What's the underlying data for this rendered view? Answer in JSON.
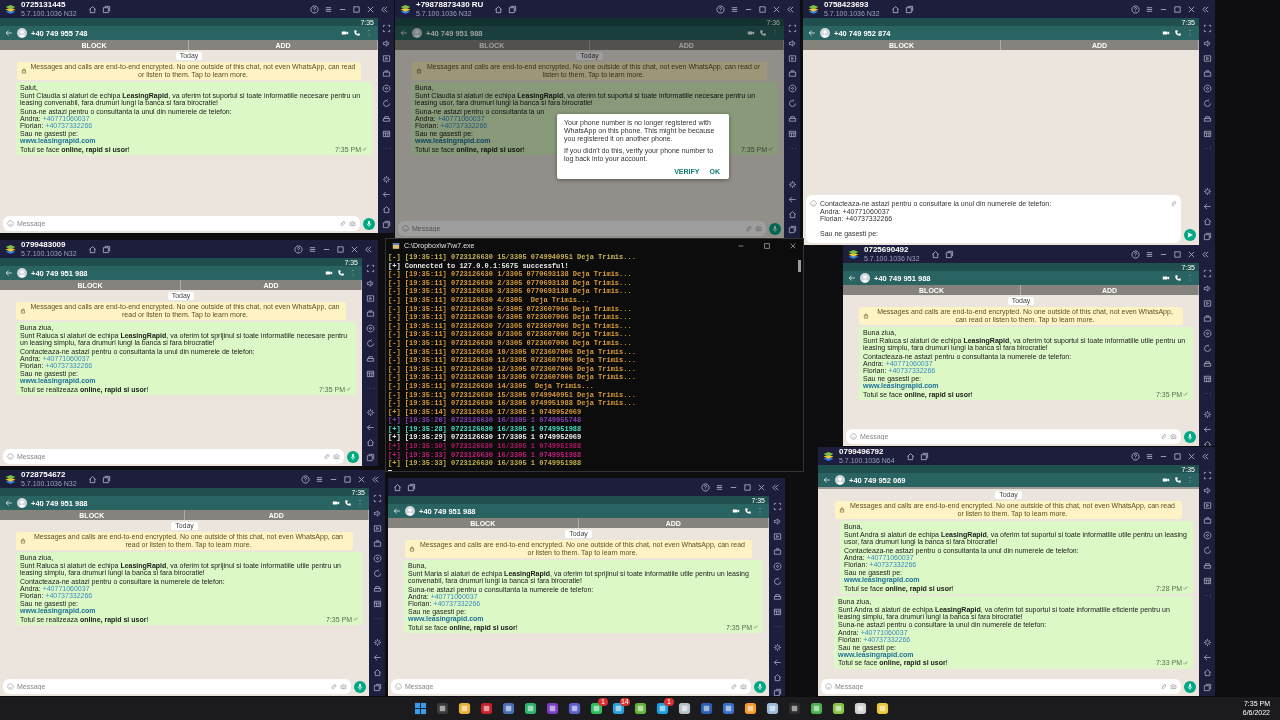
{
  "emulator_windows": [
    {
      "title": "0725131445",
      "subtitle": "5.7.100.1036 N32",
      "time": "7:35",
      "contact": "+40 749 955 748",
      "action_bar": [
        "BLOCK",
        "ADD"
      ],
      "date_chip": "Today",
      "notice": "Messages and calls are end-to-end encrypted. No one outside of this chat, not even WhatsApp, can read or listen to them. Tap to learn more.",
      "messages": [
        {
          "indent": false,
          "time": "7:35 PM",
          "paragraphs": [
            [
              {
                "text": "Salut,"
              }
            ],
            [
              {
                "text": "Sunt Claudia si alaturi de echipa **LeasingRapid**, va oferim tot suportul si toate informatiile necesare pentru un leasing convenabil, fara drumuri lungi la banca si fara birocratie!"
              }
            ],
            [
              {
                "text": "Suna-ne astazi pentru o consultanta la unul din numerele de telefon:"
              },
              {
                "label": "Andra:",
                "link": "+40771060037"
              },
              {
                "label": "Florian:",
                "link": "+40737332266"
              }
            ],
            [
              {
                "text": "Sau ne gasesti pe:"
              },
              {
                "link": "www.leasingrapid.com"
              }
            ],
            [
              {
                "text": "Totul se face **online, rapid si usor**!"
              }
            ]
          ]
        }
      ],
      "composer": {
        "placeholder": "Message"
      }
    },
    {
      "title": "+79878873430 RU",
      "subtitle": "5.7.100.1036 N32",
      "time": "7:36",
      "contact": "+40 749 951 988",
      "action_bar": [
        "BLOCK",
        "ADD"
      ],
      "date_chip": "Today",
      "notice": "Messages and calls are end-to-end encrypted. No one outside of this chat, not even WhatsApp, can read or listen to them. Tap to learn more.",
      "messages": [
        {
          "indent": false,
          "time": "7:35 PM",
          "paragraphs": [
            [
              {
                "text": "Buna,"
              }
            ],
            [
              {
                "text": "Sunt Claudia si alaturi de echipa **LeasingRapid**, va oferim tot suportul si toate informatiile necesare pentru un leasing usor, fara drumuri lungi la banca si fara birocratie!"
              }
            ],
            [
              {
                "text": "Suna-ne astazi pentru o consultanta la un"
              },
              {
                "label": "Andra:",
                "link": "+40771060037"
              },
              {
                "label": "Florian:",
                "link": "+40737332266"
              }
            ],
            [
              {
                "text": "Sau ne gasesti pe:"
              },
              {
                "link": "www.leasingrapid.com"
              }
            ],
            [
              {
                "text": "Totul se face **online, rapid si usor**!"
              }
            ]
          ]
        }
      ],
      "composer": {
        "placeholder": "Message"
      },
      "dialog": {
        "paragraphs": [
          "Your phone number is no longer registered with WhatsApp on this phone. This might be because you registered it on another phone.",
          "If you didn't do this, verify your phone number to log back into your account."
        ],
        "buttons": [
          "VERIFY",
          "OK"
        ]
      }
    },
    {
      "title": "0758423693",
      "subtitle": "5.7.100.1036 N32",
      "time": "7:35",
      "contact": "+40 749 952 874",
      "action_bar": [
        "BLOCK",
        "ADD"
      ],
      "composer": {
        "value": "Contacteaza-ne astazi pentru o consultare la unul din numerele de telefon:\nAndra: +40771060037\nFlorian: +40737332266\n\nSau ne gasesti pe:"
      }
    },
    {
      "title": "0799483009",
      "subtitle": "5.7.100.1036 N32",
      "time": "7:35",
      "contact": "+40 749 951 988",
      "action_bar": [
        "BLOCK",
        "ADD"
      ],
      "date_chip": "Today",
      "notice": "Messages and calls are end-to-end encrypted. No one outside of this chat, not even WhatsApp, can read or listen to them. Tap to learn more.",
      "messages": [
        {
          "indent": false,
          "time": "7:35 PM",
          "paragraphs": [
            [
              {
                "text": "Buna ziua,"
              }
            ],
            [
              {
                "text": "Sunt Raluca si alaturi de echipa **LeasingRapid**, va oferim tot sprijinul si toate informatiile necesare pentru un leasing simplu, fara drumuri lungi la banca si fara birocratie!"
              }
            ],
            [
              {
                "text": "Contacteaza-ne astazi pentru o consultanta la unul din numerele de telefon:"
              },
              {
                "label": "Andra:",
                "link": "+40771060037"
              },
              {
                "label": "Florian:",
                "link": "+40737332266"
              }
            ],
            [
              {
                "text": "Sau ne gasesti pe:"
              },
              {
                "link": "www.leasingrapid.com"
              }
            ],
            [
              {
                "text": "Totul se realizeaza **online, rapid si usor**!"
              }
            ]
          ]
        }
      ],
      "composer": {
        "placeholder": "Message"
      }
    },
    {
      "title": "0725690492",
      "subtitle": "5.7.100.1036 N32",
      "time": "7:35",
      "contact": "+40 749 951 988",
      "action_bar": [
        "BLOCK",
        "ADD"
      ],
      "date_chip": "Today",
      "notice": "Messages and calls are end-to-end encrypted. No one outside of this chat, not even WhatsApp, can read or listen to them. Tap to learn more.",
      "messages": [
        {
          "indent": false,
          "time": "7:35 PM",
          "paragraphs": [
            [
              {
                "text": "Buna ziua,"
              }
            ],
            [
              {
                "text": "Sunt Raluca si alaturi de echipa **LeasingRapid**, va oferim tot suportul si toate informatiile utile pentru un leasing simplu, fara drumuri lungi la banca si fara birocratie!"
              }
            ],
            [
              {
                "text": "Contacteaza-ne astazi pentru o consultanta la numerele de telefon:"
              },
              {
                "label": "Andra:",
                "link": "+40771060037"
              },
              {
                "label": "Florian:",
                "link": "+40737332266"
              }
            ],
            [
              {
                "text": "Sau ne gasesti pe:"
              },
              {
                "link": "www.leasingrapid.com"
              }
            ],
            [
              {
                "text": "Totul se face **online, rapid si usor**!"
              }
            ]
          ]
        }
      ],
      "composer": {
        "placeholder": "Message"
      }
    },
    {
      "title": "0728754672",
      "subtitle": "5.7.100.1036 N32",
      "time": "7:35",
      "contact": "+40 749 951 988",
      "action_bar": [
        "BLOCK",
        "ADD"
      ],
      "date_chip": "Today",
      "notice": "Messages and calls are end-to-end encrypted. No one outside of this chat, not even WhatsApp, can read or listen to them. Tap to learn more.",
      "messages": [
        {
          "indent": false,
          "time": "7:35 PM",
          "paragraphs": [
            [
              {
                "text": "Buna ziua,"
              }
            ],
            [
              {
                "text": "Sunt Raluca si alaturi de echipa **LeasingRapid**, va oferim tot sprijinul si toate informatiile utile pentru un leasing simplu, fara drumuri lungi la banca si fara birocratie!"
              }
            ],
            [
              {
                "text": "Contacteaza-ne astazi pentru o consultare la numerele de telefon:"
              },
              {
                "label": "Andra:",
                "link": "+40771060037"
              },
              {
                "label": "Florian:",
                "link": "+40737332266"
              }
            ],
            [
              {
                "text": "Sau ne gasesti pe:"
              },
              {
                "link": "www.leasingrapid.com"
              }
            ],
            [
              {
                "text": "Totul se realizeaza **online, rapid si usor**!"
              }
            ]
          ]
        }
      ],
      "composer": {
        "placeholder": "Message"
      }
    },
    {
      "time": "7:35",
      "contact": "+40 749 951 988",
      "action_bar": [
        "BLOCK",
        "ADD"
      ],
      "date_chip": "Today",
      "notice": "Messages and calls are end-to-end encrypted. No one outside of this chat, not even WhatsApp, can read or listen to them. Tap to learn more.",
      "messages": [
        {
          "indent": false,
          "time": "7:35 PM",
          "paragraphs": [
            [
              {
                "text": "Buna,"
              }
            ],
            [
              {
                "text": "Sunt Maria si alaturi de echipa **LeasingRapid**, va oferim tot sprijinul si toate informatiile utile pentru un leasing convenabil, fara drumuri lungi la banca si fara birocratie!"
              }
            ],
            [
              {
                "text": "Suna-ne astazi pentru o consultanta la numerele de telefon:"
              },
              {
                "label": "Andra:",
                "link": "+40771060037"
              },
              {
                "label": "Florian:",
                "link": "+40737332266"
              }
            ],
            [
              {
                "text": "Sau ne gasesti pe:"
              },
              {
                "link": "www.leasingrapid.com"
              }
            ],
            [
              {
                "text": "Totul se face **online, rapid si usor**!"
              }
            ]
          ]
        }
      ],
      "composer": {
        "placeholder": "Message"
      }
    },
    {
      "title": "0799496792",
      "subtitle": "5.7.100.1036 N64",
      "time": "7:35",
      "contact": "+40 749 952 069",
      "date_chip": "Today",
      "notice": "Messages and calls are end-to-end encrypted. No one outside of this chat, not even WhatsApp, can read or listen to them. Tap to learn more.",
      "messages": [
        {
          "indent": true,
          "time": "7:28 PM",
          "paragraphs": [
            [
              {
                "text": "Buna,"
              }
            ],
            [
              {
                "text": "Sunt Andra si alaturi de echipa **LeasingRapid**, va oferim tot suportul si toate informatiile utile pentru un leasing usor, fara drumuri lungi la banca si fara birocratie!"
              }
            ],
            [
              {
                "text": "Contacteaza-ne astazi pentru o consultanta la unul din numerele de telefon:"
              },
              {
                "label": "Andra:",
                "link": "+40771060037"
              },
              {
                "label": "Florian:",
                "link": "+40737332266"
              }
            ],
            [
              {
                "text": "Sau ne gasesti pe:"
              },
              {
                "link": "www.leasingrapid.com"
              }
            ],
            [
              {
                "text": "Totul se face **online, rapid si usor**!"
              }
            ]
          ]
        },
        {
          "indent": false,
          "time": "7:33 PM",
          "paragraphs": [
            [
              {
                "text": "Buna ziua,"
              }
            ],
            [
              {
                "text": "Sunt Andra si alaturi de echipa **LeasingRapid**, va oferim tot suportul si toate informatiile eficiente pentru un leasing simplu, fara drumuri lungi la banca si fara birocratie!"
              }
            ],
            [
              {
                "text": "Suna-ne astazi pentru o consultare la unul din numerele de telefon:"
              },
              {
                "label": "Andra:",
                "link": "+40771060037"
              },
              {
                "label": "Florian:",
                "link": "+40737332266"
              }
            ],
            [
              {
                "text": "Sau ne gasesti pe:"
              },
              {
                "link": "www.leasingrapid.com"
              }
            ],
            [
              {
                "text": "Totul se face **online, rapid si usor**!"
              }
            ]
          ]
        }
      ],
      "composer": {
        "placeholder": "Message"
      }
    }
  ],
  "console": {
    "title": "C:\\Dropbox\\w7\\w7.exe",
    "lines": [
      {
        "text": "[-] [19:35:11] 0723126630 15/3305 0749940951 Deja Trimis...",
        "color": "#c9b458"
      },
      {
        "text": "[+] Connected to 127.0.0.1:5675 successful!",
        "color": "#e8e8e8"
      },
      {
        "text": "[-] [19:35:11] 0723126630 1/3305 0770693138 Deja Trimis...",
        "color": "#d99a3a"
      },
      {
        "text": "[-] [19:35:11] 0723126630 2/3305 0770693138 Deja Trimis...",
        "color": "#d99a3a"
      },
      {
        "text": "[-] [19:35:11] 0723126630 3/3305 0770693138 Deja Trimis...",
        "color": "#d99a3a"
      },
      {
        "text": "[-] [19:35:11] 0723126630 4/3305  Deja Trimis...",
        "color": "#d99a3a"
      },
      {
        "text": "[-] [19:35:11] 0723126630 5/3305 0723607006 Deja Trimis...",
        "color": "#d99a3a"
      },
      {
        "text": "[-] [19:35:11] 0723126630 6/3305 0723607006 Deja Trimis...",
        "color": "#d99a3a"
      },
      {
        "text": "[-] [19:35:11] 0723126630 7/3305 0723607006 Deja Trimis...",
        "color": "#d99a3a"
      },
      {
        "text": "[-] [19:35:11] 0723126630 8/3305 0723607006 Deja Trimis...",
        "color": "#d99a3a"
      },
      {
        "text": "[-] [19:35:11] 0723126630 9/3305 0723607006 Deja Trimis...",
        "color": "#d99a3a"
      },
      {
        "text": "[-] [19:35:11] 0723126630 10/3305 0723607006 Deja Trimis...",
        "color": "#d99a3a"
      },
      {
        "text": "[-] [19:35:11] 0723126630 11/3305 0723607006 Deja Trimis...",
        "color": "#d99a3a"
      },
      {
        "text": "[-] [19:35:11] 0723126630 12/3305 0723607006 Deja Trimis...",
        "color": "#d99a3a"
      },
      {
        "text": "[-] [19:35:11] 0723126630 13/3305 0723607006 Deja Trimis...",
        "color": "#d99a3a"
      },
      {
        "text": "[-] [19:35:11] 0723126630 14/3305  Deja Trimis...",
        "color": "#d99a3a"
      },
      {
        "text": "[-] [19:35:11] 0723126630 15/3305 0749940951 Deja Trimis...",
        "color": "#d99a3a"
      },
      {
        "text": "[-] [19:35:11] 0723126630 16/3305 0749951988 Deja Trimis...",
        "color": "#d99a3a"
      },
      {
        "text": "[+] [19:35:14] 0723126630 17/3305 1 0749952069",
        "color": "#d99a3a"
      },
      {
        "text": "[+] [19:35:20] 0723126630 16/3305 1 0749955748",
        "color": "#8a3fb8"
      },
      {
        "text": "[+] [19:35:28] 0723126630 16/3305 1 0749951988",
        "color": "#45e0c8"
      },
      {
        "text": "[+] [19:35:29] 0723126630 17/3305 1 0749952069",
        "color": "#f0f0f0"
      },
      {
        "text": "[+] [19:35:30] 0723126630 16/3305 1 0749951988",
        "color": "#b0186a"
      },
      {
        "text": "[+] [19:35:33] 0723126630 16/3305 1 0749951988",
        "color": "#c81c80"
      },
      {
        "text": "[+] [19:35:33] 0723126630 16/3305 1 0749951988",
        "color": "#c2b04a"
      }
    ]
  },
  "taskbar": {
    "apps": [
      {
        "kind": "start",
        "color": "#3a9be8"
      },
      {
        "kind": "app",
        "color": "#3a3a3a"
      },
      {
        "kind": "app",
        "color": "#e8b13a"
      },
      {
        "kind": "app",
        "color": "#c8202a"
      },
      {
        "kind": "app",
        "color": "#4a6fb5"
      },
      {
        "kind": "app",
        "color": "#2fb36b"
      },
      {
        "kind": "app",
        "color": "#7b3fc4"
      },
      {
        "kind": "app",
        "color": "#5b5fc7"
      },
      {
        "kind": "app",
        "color": "#2fbf60",
        "badge": "1"
      },
      {
        "kind": "app",
        "color": "#2aa1da",
        "badge": "14"
      },
      {
        "kind": "app",
        "color": "#64b33f"
      },
      {
        "kind": "app",
        "color": "#1ea0e0",
        "badge": "1"
      },
      {
        "kind": "app",
        "color": "#b8c0c8"
      },
      {
        "kind": "app",
        "color": "#2b5fb0"
      },
      {
        "kind": "app",
        "color": "#3b6fc8"
      },
      {
        "kind": "app",
        "color": "#f29a2e"
      },
      {
        "kind": "app",
        "color": "#9bbbd8"
      },
      {
        "kind": "app",
        "color": "#2d2d2d"
      },
      {
        "kind": "app",
        "color": "#4caf50"
      },
      {
        "kind": "app",
        "color": "#8bc34a"
      },
      {
        "kind": "app",
        "color": "#d0d0d0"
      },
      {
        "kind": "app",
        "color": "#e8c83a"
      }
    ],
    "time": "7:35 PM",
    "date": "6/6/2022"
  }
}
